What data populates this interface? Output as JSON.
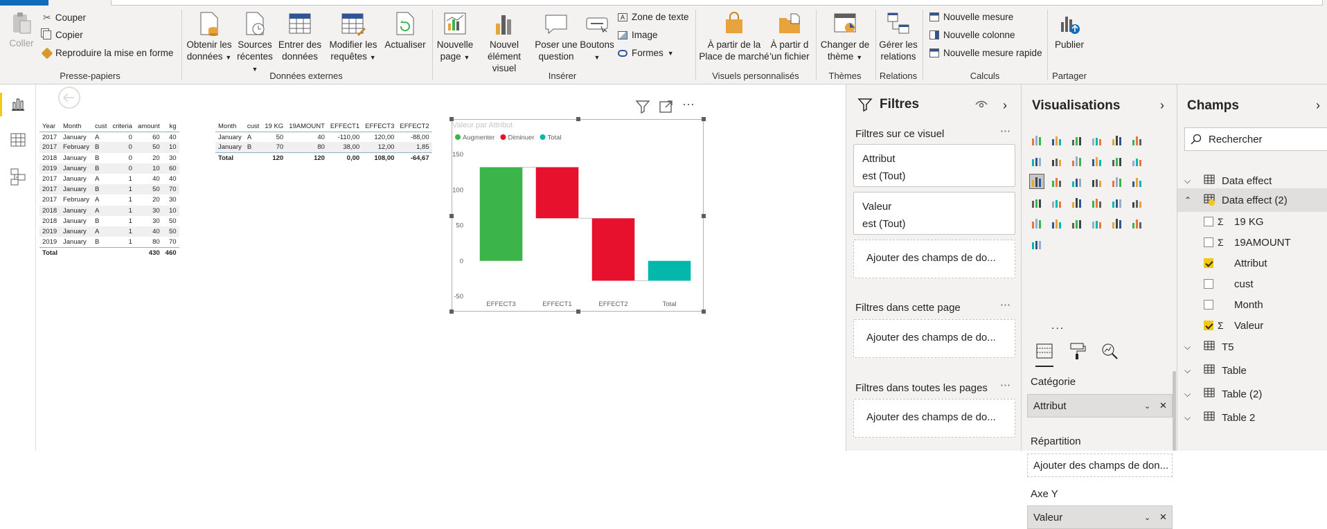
{
  "ribbon": {
    "clipboard": {
      "paste": "Coller",
      "cut": "Couper",
      "copy": "Copier",
      "format_painter": "Reproduire la mise en forme",
      "group": "Presse-papiers"
    },
    "external_data": {
      "get_data": [
        "Obtenir les",
        "données"
      ],
      "recent_sources": [
        "Sources",
        "récentes"
      ],
      "enter_data": [
        "Entrer des",
        "données"
      ],
      "edit_queries": [
        "Modifier les",
        "requêtes"
      ],
      "refresh": "Actualiser",
      "group": "Données externes"
    },
    "insert": {
      "new_page": [
        "Nouvelle",
        "page"
      ],
      "new_visual": [
        "Nouvel",
        "élément visuel"
      ],
      "ask_question": [
        "Poser une",
        "question"
      ],
      "buttons": "Boutons",
      "text_box": "Zone de texte",
      "image": "Image",
      "shapes": "Formes",
      "group": "Insérer"
    },
    "custom_visuals": {
      "marketplace": [
        "À partir de la",
        "Place de marché"
      ],
      "from_file": [
        "À partir d",
        "'un fichier"
      ],
      "group": "Visuels personnalisés"
    },
    "themes": {
      "switch": [
        "Changer de",
        "thème"
      ],
      "group": "Thèmes"
    },
    "relations": {
      "manage": [
        "Gérer les",
        "relations"
      ],
      "group": "Relations"
    },
    "calculations": {
      "new_measure": "Nouvelle mesure",
      "new_column": "Nouvelle colonne",
      "quick_measure": "Nouvelle mesure rapide",
      "group": "Calculs"
    },
    "share": {
      "publish": "Publier",
      "group": "Partager"
    }
  },
  "table1": {
    "headers": [
      "Year",
      "Month",
      "cust",
      "criteria",
      "amount",
      "kg"
    ],
    "rows": [
      [
        "2017",
        "January",
        "A",
        "0",
        "60",
        "40"
      ],
      [
        "2017",
        "February",
        "B",
        "0",
        "50",
        "10"
      ],
      [
        "2018",
        "January",
        "B",
        "0",
        "20",
        "30"
      ],
      [
        "2019",
        "January",
        "B",
        "0",
        "10",
        "60"
      ],
      [
        "2017",
        "January",
        "A",
        "1",
        "40",
        "40"
      ],
      [
        "2017",
        "January",
        "B",
        "1",
        "50",
        "70"
      ],
      [
        "2017",
        "February",
        "A",
        "1",
        "20",
        "30"
      ],
      [
        "2018",
        "January",
        "A",
        "1",
        "30",
        "10"
      ],
      [
        "2018",
        "January",
        "B",
        "1",
        "30",
        "50"
      ],
      [
        "2019",
        "January",
        "A",
        "1",
        "40",
        "50"
      ],
      [
        "2019",
        "January",
        "B",
        "1",
        "80",
        "70"
      ]
    ],
    "total": [
      "Total",
      "",
      "",
      "",
      "430",
      "460"
    ]
  },
  "table2": {
    "headers": [
      "Month",
      "cust",
      "19 KG",
      "19AMOUNT",
      "EFFECT1",
      "EFFECT3",
      "EFFECT2"
    ],
    "rows": [
      [
        "January",
        "A",
        "50",
        "40",
        "-110,00",
        "120,00",
        "-88,00"
      ],
      [
        "January",
        "B",
        "70",
        "80",
        "38,00",
        "12,00",
        "1,85"
      ]
    ],
    "total": [
      "Total",
      "",
      "120",
      "120",
      "0,00",
      "108,00",
      "-64,67"
    ]
  },
  "chart_data": {
    "type": "waterfall",
    "title": "Valeur par Attribut",
    "legend": [
      {
        "name": "Augmenter",
        "color": "#3bb54a"
      },
      {
        "name": "Diminuer",
        "color": "#e8112d"
      },
      {
        "name": "Total",
        "color": "#01b8aa"
      }
    ],
    "legend_position": "top-left",
    "categories": [
      "EFFECT3",
      "EFFECT1",
      "EFFECT2",
      "Total"
    ],
    "values": [
      132,
      -72,
      -88,
      -28
    ],
    "kinds": [
      "increase",
      "decrease",
      "decrease",
      "total"
    ],
    "y_ticks": [
      "150",
      "100",
      "50",
      "0",
      "-50"
    ],
    "ylim": [
      -50,
      150
    ]
  },
  "filters": {
    "title": "Filtres",
    "on_visual": "Filtres sur ce visuel",
    "card1": [
      "Attribut",
      "est (Tout)"
    ],
    "card2": [
      "Valeur",
      "est (Tout)"
    ],
    "add_fields": "Ajouter des champs de do...",
    "on_page": "Filtres dans cette page",
    "all_pages": "Filtres dans toutes les pages"
  },
  "visualizations": {
    "title": "Visualisations",
    "more": "...",
    "category_label": "Catégorie",
    "category_value": "Attribut",
    "breakdown_label": "Répartition",
    "breakdown_placeholder": "Ajouter des champs de don...",
    "yaxis_label": "Axe Y",
    "yaxis_value": "Valeur"
  },
  "fields": {
    "title": "Champs",
    "search_placeholder": "Rechercher",
    "tables": [
      {
        "name": "Data effect"
      },
      {
        "name": "Data effect (2)"
      }
    ],
    "items": [
      {
        "name": "19 KG",
        "sigma": true,
        "checked": false
      },
      {
        "name": "19AMOUNT",
        "sigma": true,
        "checked": false
      },
      {
        "name": "Attribut",
        "sigma": false,
        "checked": true
      },
      {
        "name": "cust",
        "sigma": false,
        "checked": false
      },
      {
        "name": "Month",
        "sigma": false,
        "checked": false
      },
      {
        "name": "Valeur",
        "sigma": true,
        "checked": true
      }
    ],
    "more_tables": [
      "T5",
      "Table",
      "Table (2)",
      "Table 2"
    ]
  }
}
